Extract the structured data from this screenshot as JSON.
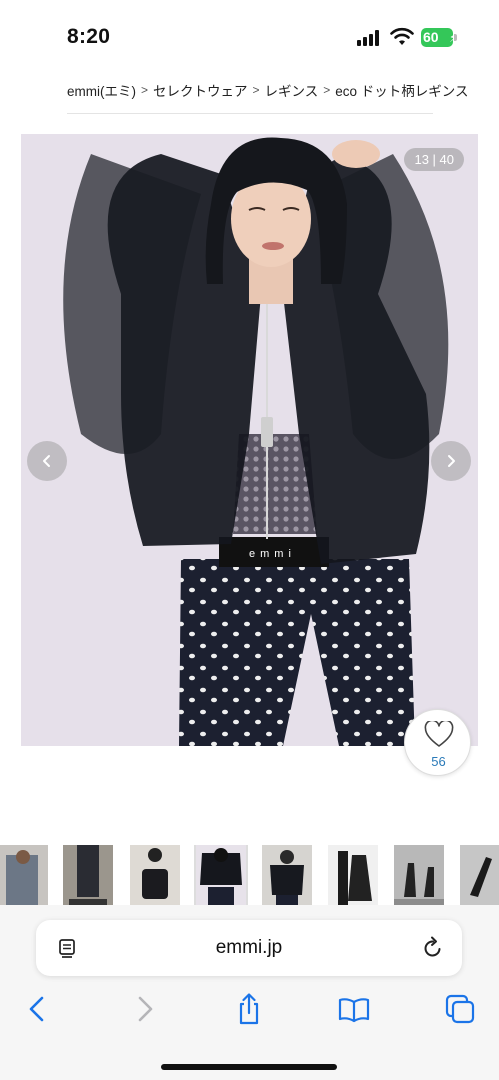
{
  "status_bar": {
    "time": "8:20",
    "battery_level": "60",
    "signal_icon": "cellular-signal-icon",
    "wifi_icon": "wifi-icon",
    "battery_color": "#34c759"
  },
  "breadcrumb": {
    "items": [
      "emmi(エミ)",
      "セレクトウェア",
      "レギンス",
      "eco ドット柄レギンス"
    ],
    "separator": ">"
  },
  "gallery": {
    "counter": "13 | 40",
    "current_index": 13,
    "total": 40,
    "prev_icon": "chevron-left-icon",
    "next_icon": "chevron-right-icon",
    "image_subject": "model in black tulle zip jacket and polka dot leggings",
    "image_overlay_text": "emmi"
  },
  "like": {
    "icon": "heart-outline-icon",
    "count": "56",
    "count_color": "#2a7ab8"
  },
  "thumbnails": [
    {
      "name": "thumb-1",
      "bg": "#8a8f96"
    },
    {
      "name": "thumb-2",
      "bg": "#c7c2ba"
    },
    {
      "name": "thumb-3",
      "bg": "#dcdcd8"
    },
    {
      "name": "thumb-4",
      "bg": "#e7e2ea",
      "active": true
    },
    {
      "name": "thumb-5",
      "bg": "#d9d6d2"
    },
    {
      "name": "thumb-6",
      "bg": "#ececec"
    },
    {
      "name": "thumb-7",
      "bg": "#b9b9b9"
    },
    {
      "name": "thumb-8",
      "bg": "#c3c3c3"
    }
  ],
  "browser": {
    "url": "emmi.jp",
    "reader_icon": "reader-mode-icon",
    "reload_icon": "reload-icon",
    "toolbar": [
      "back-icon",
      "forward-icon",
      "share-icon",
      "bookmarks-icon",
      "tabs-icon"
    ],
    "accent": "#1b74e8"
  }
}
